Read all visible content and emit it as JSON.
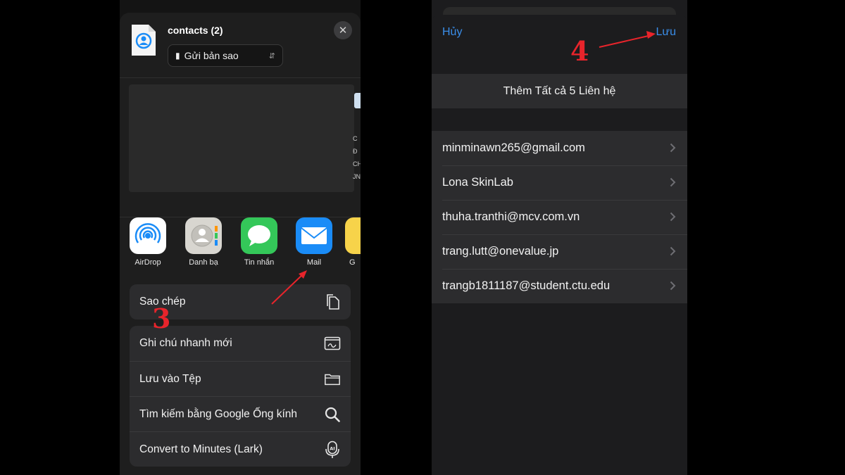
{
  "share_sheet": {
    "file_title": "contacts (2)",
    "send_option": "Gửi bản sao",
    "preview_peek_text": "C\nĐ\nCH\nJN",
    "apps": [
      {
        "label": "AirDrop",
        "icon": "airdrop-icon"
      },
      {
        "label": "Danh bạ",
        "icon": "contacts-icon"
      },
      {
        "label": "Tin nhắn",
        "icon": "messages-icon"
      },
      {
        "label": "Mail",
        "icon": "mail-icon"
      },
      {
        "label": "G",
        "icon": "notes-icon"
      }
    ],
    "copy_action": {
      "label": "Sao chép",
      "icon": "copy-icon"
    },
    "actions": [
      {
        "label": "Ghi chú nhanh mới",
        "icon": "quick-note-icon"
      },
      {
        "label": "Lưu vào Tệp",
        "icon": "folder-icon"
      },
      {
        "label": "Tìm kiếm bằng Google Ống kính",
        "icon": "search-icon"
      },
      {
        "label": "Convert to Minutes (Lark)",
        "icon": "ai-mic-icon"
      }
    ],
    "step_marker": "3"
  },
  "contacts_modal": {
    "cancel_label": "Hủy",
    "save_label": "Lưu",
    "add_all_label": "Thêm Tất cả 5 Liên hệ",
    "contacts": [
      "minminawn265@gmail.com",
      "Lona SkinLab",
      "thuha.tranthi@mcv.com.vn",
      "trang.lutt@onevalue.jp",
      "trangb1811187@student.ctu.edu"
    ],
    "step_marker": "4"
  },
  "colors": {
    "accent_blue": "#3a8eea",
    "annotation_red": "#e8242b",
    "panel": "#2c2c2e",
    "background": "#000000"
  }
}
